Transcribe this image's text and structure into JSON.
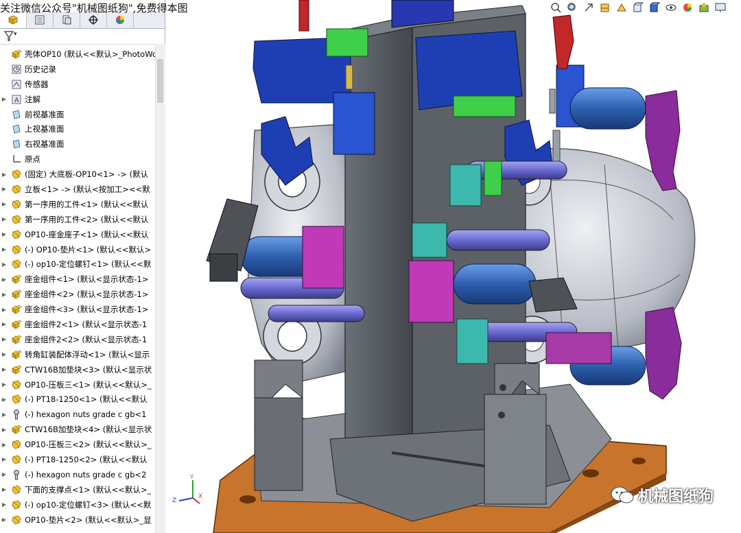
{
  "watermark": "关注微信公众号\"机械图纸狗\",免费得本图",
  "tabs": [
    {
      "name": "feature-manager-tab-icon"
    },
    {
      "name": "property-manager-tab-icon"
    },
    {
      "name": "configuration-manager-tab-icon"
    },
    {
      "name": "dimxpert-tab-icon"
    },
    {
      "name": "display-manager-tab-icon"
    }
  ],
  "filter_symbol": "▾",
  "tree": [
    {
      "label": "壳体OP10 (默认<<默认>_PhotoWo",
      "icon": "assembly",
      "exp": ""
    },
    {
      "label": "历史记录",
      "icon": "history",
      "exp": ""
    },
    {
      "label": "传感器",
      "icon": "sensor",
      "exp": ""
    },
    {
      "label": "注解",
      "icon": "annotation",
      "exp": "▶"
    },
    {
      "label": "前视基准面",
      "icon": "plane",
      "exp": ""
    },
    {
      "label": "上视基准面",
      "icon": "plane",
      "exp": ""
    },
    {
      "label": "右视基准面",
      "icon": "plane",
      "exp": ""
    },
    {
      "label": "原点",
      "icon": "origin",
      "exp": ""
    },
    {
      "label": "(固定) 大底板-OP10<1> -> (默认",
      "icon": "part",
      "exp": "▶"
    },
    {
      "label": "立板<1> -> (默认<按加工><<默",
      "icon": "part",
      "exp": "▶"
    },
    {
      "label": "第一序用的工件<1> (默认<<默认",
      "icon": "part",
      "exp": "▶"
    },
    {
      "label": "第一序用的工件<2> (默认<<默认",
      "icon": "part",
      "exp": "▶"
    },
    {
      "label": "OP10-座金座子<1> (默认<<默认",
      "icon": "part",
      "exp": "▶"
    },
    {
      "label": "(-) OP10-垫片<1> (默认<<默认>",
      "icon": "part",
      "exp": "▶"
    },
    {
      "label": "(-) op10-定位螺钉<1> (默认<<默",
      "icon": "part",
      "exp": "▶"
    },
    {
      "label": "座金组件<1> (默认<显示状态-1>",
      "icon": "assembly",
      "exp": "▶"
    },
    {
      "label": "座金组件<2> (默认<显示状态-1>",
      "icon": "assembly",
      "exp": "▶"
    },
    {
      "label": "座金组件<3> (默认<显示状态-1>",
      "icon": "assembly",
      "exp": "▶"
    },
    {
      "label": "座金组件2<1> (默认<显示状态-1",
      "icon": "assembly",
      "exp": "▶"
    },
    {
      "label": "座金组件2<2> (默认<显示状态-1",
      "icon": "assembly",
      "exp": "▶"
    },
    {
      "label": "转角缸装配体浮动<1> (默认<显示",
      "icon": "assembly",
      "exp": "▶"
    },
    {
      "label": "CTW16B加垫块<3> (默认<显示状",
      "icon": "assembly",
      "exp": "▶"
    },
    {
      "label": "OP10-压板三<1> (默认<<默认>_",
      "icon": "part",
      "exp": "▶"
    },
    {
      "label": "(-) PT18-1250<1> (默认<<默认",
      "icon": "part",
      "exp": "▶"
    },
    {
      "label": "(-) hexagon nuts grade c gb<1",
      "icon": "toolbox",
      "exp": "▶"
    },
    {
      "label": "CTW16B加垫块<4> (默认<显示状",
      "icon": "assembly",
      "exp": "▶"
    },
    {
      "label": "OP10-压板三<2> (默认<<默认>_",
      "icon": "part",
      "exp": "▶"
    },
    {
      "label": "(-) PT18-1250<2> (默认<<默认",
      "icon": "part",
      "exp": "▶"
    },
    {
      "label": "(-) hexagon nuts grade c gb<2",
      "icon": "toolbox",
      "exp": "▶"
    },
    {
      "label": "下面的支撑点<1> (默认<<默认>_",
      "icon": "part",
      "exp": "▶"
    },
    {
      "label": "(-) op10-定位螺钉<3> (默认<<默",
      "icon": "part",
      "exp": "▶"
    },
    {
      "label": "OP10-垫片<2> (默认<<默认>_显",
      "icon": "part",
      "exp": "▶"
    }
  ],
  "toolbar": [
    "zoom-to-fit-icon",
    "zoom-area-icon",
    "previous-view-icon",
    "section-view-icon",
    "dynamic-annotation-icon",
    "view-orientation-icon",
    "display-style-icon",
    "hide-show-icon",
    "edit-appearance-icon",
    "apply-scene-icon",
    "view-settings-icon"
  ],
  "logo": {
    "text": "机械图纸狗"
  },
  "triad": {
    "x": "X",
    "y": "Y",
    "z": "Z"
  },
  "colors": {
    "base": "#c8742c",
    "column": "#555a60",
    "clamp_blue": "#1e3fb4",
    "cylinder": "#2e5fae",
    "purple": "#8a2c9a",
    "teal": "#3db8ad",
    "green": "#3fcf4a",
    "housing": "#c6cad2",
    "rod": "#6a6ad2"
  }
}
